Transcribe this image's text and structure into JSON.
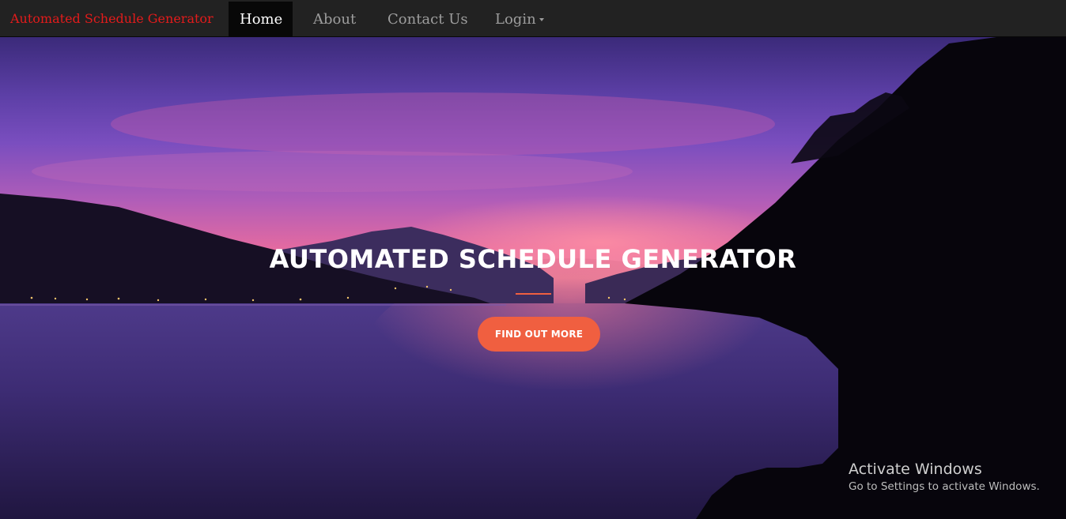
{
  "navbar": {
    "brand": "Automated Schedule Generator",
    "items": [
      {
        "label": "Home",
        "active": true
      },
      {
        "label": "About",
        "active": false
      },
      {
        "label": "Contact Us",
        "active": false
      },
      {
        "label": "Login",
        "active": false,
        "has_dropdown": true
      }
    ]
  },
  "hero": {
    "title": "AUTOMATED SCHEDULE GENERATOR",
    "cta_label": "FIND OUT MORE"
  },
  "watermark": {
    "title": "Activate Windows",
    "subtitle": "Go to Settings to activate Windows."
  },
  "colors": {
    "brand": "#e31b1b",
    "navbar_bg": "#222222",
    "active_bg": "#080808",
    "accent": "#f05f40"
  },
  "icons": [
    "caret-down-icon"
  ]
}
